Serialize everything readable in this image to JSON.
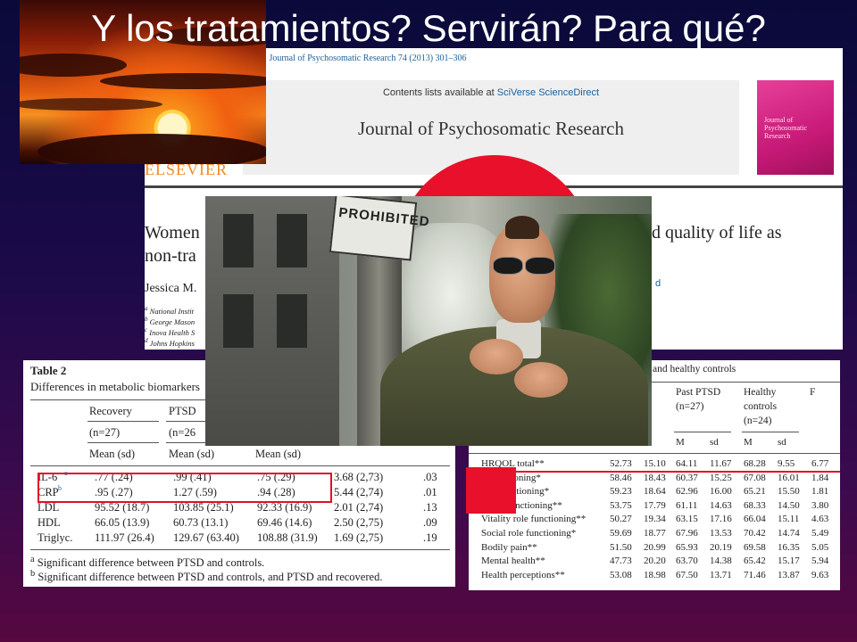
{
  "slide": {
    "title": "Y los tratamientos? Servirán? Para qué?"
  },
  "article": {
    "citation": "Journal of Psychosomatic Research 74 (2013) 301–306",
    "contents_prefix": "Contents lists available at ",
    "contents_link": "SciVerse ScienceDirect",
    "journal_name": "Journal of Psychosomatic Research",
    "publisher": "ELSEVIER",
    "cover_text": "Journal of Psychosomatic Research",
    "title_left_1": "Women",
    "title_right_1": "d quality of life as",
    "title_left_2": "non-tra",
    "author": "Jessica M.",
    "author_marker": "d",
    "affiliations": [
      "National Instit",
      "George Mason",
      "Inova Health S",
      "Johns Hopkins"
    ],
    "affiliation_marks": [
      "a",
      "b",
      "c",
      "d"
    ]
  },
  "table2": {
    "caption": "Table 2",
    "subtitle": "Differences in metabolic biomarkers",
    "col_recovery": "Recovery",
    "col_ptsd": "PTSD",
    "n_recovery": "(n=27)",
    "n_ptsd": "(n=26",
    "mean_sd": "Mean (sd)",
    "rows": [
      {
        "label": "IL-6",
        "sup": "a",
        "recovery": ".77 (.24)",
        "ptsd": ".99 (.41)",
        "controls": ".75 (.29)",
        "f": "3.68 (2,73)",
        "p": ".03"
      },
      {
        "label": "CRP",
        "sup": "b",
        "recovery": ".95 (.27)",
        "ptsd": "1.27 (.59)",
        "controls": ".94 (.28)",
        "f": "5.44 (2,74)",
        "p": ".01"
      },
      {
        "label": "LDL",
        "sup": "",
        "recovery": "95.52 (18.7)",
        "ptsd": "103.85 (25.1)",
        "controls": "92.33 (16.9)",
        "f": "2.01 (2,74)",
        "p": ".13"
      },
      {
        "label": "HDL",
        "sup": "",
        "recovery": "66.05 (13.9)",
        "ptsd": "60.73 (13.1)",
        "controls": "69.46 (14.6)",
        "f": "2.50 (2,75)",
        "p": ".09"
      },
      {
        "label": "Triglyc.",
        "sup": "",
        "recovery": "111.97 (26.4)",
        "ptsd": "129.67 (63.40)",
        "controls": "108.88 (31.9)",
        "f": "1.69 (2,75)",
        "p": ".19"
      }
    ],
    "notes": [
      {
        "mark": "a",
        "text": "Significant difference between PTSD and controls."
      },
      {
        "mark": "b",
        "text": "Significant difference between PTSD and controls, and PTSD and recovered."
      }
    ]
  },
  "table3": {
    "caption_tail": "and healthy controls",
    "col_past_ptsd": "Past PTSD",
    "n_past_ptsd": "(n=27)",
    "col_healthy": "Healthy",
    "col_healthy_2": "controls",
    "n_healthy": "(n=24)",
    "col_f": "F",
    "m": "M",
    "sd": "sd",
    "rows": [
      {
        "label": "HRQOL total**",
        "c1": "52.73",
        "c2": "15.10",
        "c3": "64.11",
        "c4": "11.67",
        "c5": "68.28",
        "c6": "9.55",
        "c7": "6.77"
      },
      {
        "label": "al functioning*",
        "c1": "58.46",
        "c2": "18.43",
        "c3": "60.37",
        "c4": "15.25",
        "c5": "67.08",
        "c6": "16.01",
        "c7": "1.84"
      },
      {
        "label": "role functioning*",
        "c1": "59.23",
        "c2": "18.64",
        "c3": "62.96",
        "c4": "16.00",
        "c5": "65.21",
        "c6": "15.50",
        "c7": "1.81"
      },
      {
        "label": "n-role functioning**",
        "c1": "53.75",
        "c2": "17.79",
        "c3": "61.11",
        "c4": "14.63",
        "c5": "68.33",
        "c6": "14.50",
        "c7": "3.80"
      },
      {
        "label": "Vitality role functioning**",
        "c1": "50.27",
        "c2": "19.34",
        "c3": "63.15",
        "c4": "17.16",
        "c5": "66.04",
        "c6": "15.11",
        "c7": "4.63"
      },
      {
        "label": "Social role functioning*",
        "c1": "59.69",
        "c2": "18.77",
        "c3": "67.96",
        "c4": "13.53",
        "c5": "70.42",
        "c6": "14.74",
        "c7": "5.49"
      },
      {
        "label": "Bodily pain**",
        "c1": "51.50",
        "c2": "20.99",
        "c3": "65.93",
        "c4": "20.19",
        "c5": "69.58",
        "c6": "16.35",
        "c7": "5.05"
      },
      {
        "label": "Mental health**",
        "c1": "47.73",
        "c2": "20.20",
        "c3": "63.70",
        "c4": "14.38",
        "c5": "65.42",
        "c6": "15.17",
        "c7": "5.94"
      },
      {
        "label": "Health perceptions**",
        "c1": "53.08",
        "c2": "18.98",
        "c3": "67.50",
        "c4": "13.71",
        "c5": "71.46",
        "c6": "13.87",
        "c7": "9.63"
      }
    ]
  },
  "photo": {
    "sign_text": "PROHIBITED"
  },
  "colors": {
    "accent_red": "#e8102a",
    "elsevier_orange": "#f08a24",
    "link_blue": "#1b5f9a"
  }
}
